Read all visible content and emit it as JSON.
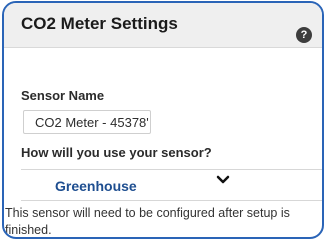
{
  "dialog": {
    "title": "CO2 Meter Settings",
    "help_icon": "help-icon",
    "help_glyph": "?"
  },
  "form": {
    "sensor_name_label": "Sensor Name",
    "sensor_name_value": "CO2 Meter - 45378'",
    "usage_label": "How will you use your sensor?",
    "usage_selected": "Greenhouse",
    "usage_chevron_icon": "chevron-down-icon",
    "notice": "This sensor will need to be configured after setup is finished."
  },
  "colors": {
    "border_accent": "#2a64b7",
    "header_background": "#efefef",
    "select_text": "#1e4e90"
  }
}
